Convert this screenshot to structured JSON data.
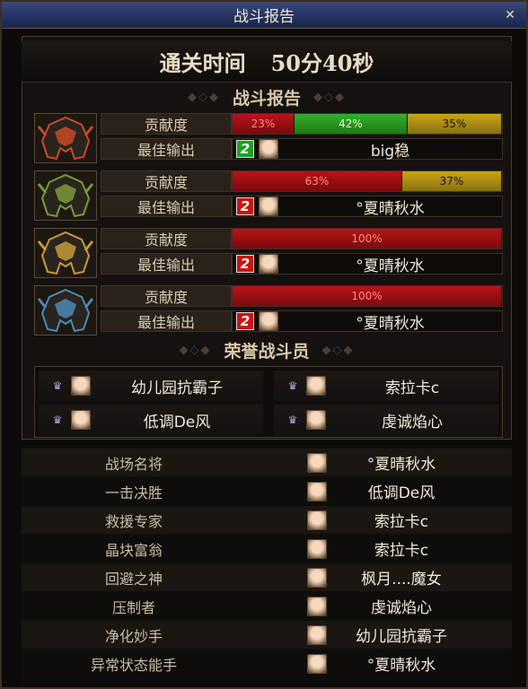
{
  "window": {
    "title": "战斗报告",
    "close_symbol": "✕"
  },
  "clear_time": {
    "label": "通关时间",
    "value": "50分40秒"
  },
  "battle_report": {
    "header": "战斗报告",
    "contribution_label": "贡献度",
    "best_output_label": "最佳输出",
    "teams": [
      {
        "helm_icon": "red-helmet-icon",
        "helm_color": "#c84a28",
        "segments": [
          {
            "value": "23%",
            "fraction": 0.23,
            "color": "red"
          },
          {
            "value": "42%",
            "fraction": 0.42,
            "color": "green"
          },
          {
            "value": "35%",
            "fraction": 0.35,
            "color": "gold"
          }
        ],
        "best_badge": "2",
        "badge_color": "green",
        "best_player": "big稳"
      },
      {
        "helm_icon": "green-helmet-icon",
        "helm_color": "#7a9a3a",
        "segments": [
          {
            "value": "63%",
            "fraction": 0.63,
            "color": "red"
          },
          {
            "value": "37%",
            "fraction": 0.37,
            "color": "gold"
          }
        ],
        "best_badge": "2",
        "badge_color": "red",
        "best_player": "°夏晴秋水"
      },
      {
        "helm_icon": "gold-helmet-icon",
        "helm_color": "#c89a3a",
        "segments": [
          {
            "value": "100%",
            "fraction": 1.0,
            "color": "red"
          }
        ],
        "best_badge": "2",
        "badge_color": "red",
        "best_player": "°夏晴秋水"
      },
      {
        "helm_icon": "blue-helmet-icon",
        "helm_color": "#4a8ab8",
        "segments": [
          {
            "value": "100%",
            "fraction": 1.0,
            "color": "red"
          }
        ],
        "best_badge": "2",
        "badge_color": "red",
        "best_player": "°夏晴秋水"
      }
    ]
  },
  "honor": {
    "header": "荣誉战斗员",
    "members": [
      {
        "name": "幼儿园抗霸子"
      },
      {
        "name": "索拉卡c"
      },
      {
        "name": "低调De风"
      },
      {
        "name": "虔诚焰心"
      }
    ]
  },
  "awards": [
    {
      "title": "战场名将",
      "player": "°夏晴秋水"
    },
    {
      "title": "一击决胜",
      "player": "低调De风"
    },
    {
      "title": "救援专家",
      "player": "索拉卡c"
    },
    {
      "title": "晶块富翁",
      "player": "索拉卡c"
    },
    {
      "title": "回避之神",
      "player": "枫月....魔女"
    },
    {
      "title": "压制者",
      "player": "虔诚焰心"
    },
    {
      "title": "净化妙手",
      "player": "幼儿园抗霸子"
    },
    {
      "title": "异常状态能手",
      "player": "°夏晴秋水"
    }
  ]
}
